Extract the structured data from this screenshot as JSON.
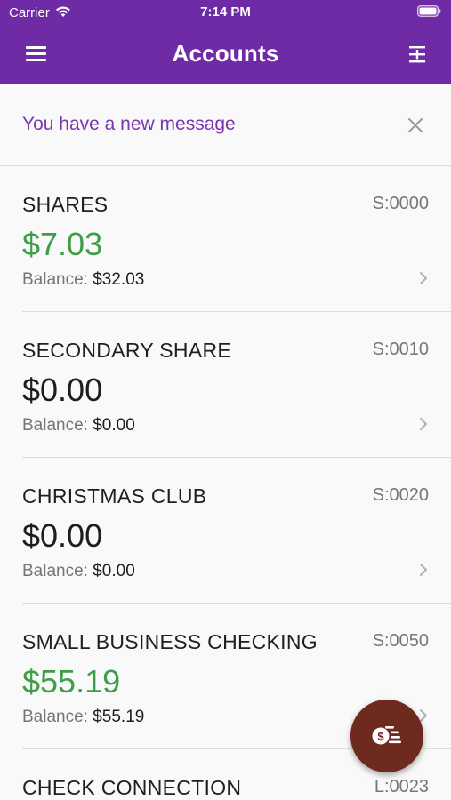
{
  "status_bar": {
    "carrier": "Carrier",
    "time": "7:14 PM"
  },
  "nav": {
    "title": "Accounts"
  },
  "message": {
    "text": "You have a new message"
  },
  "accounts": [
    {
      "name": "SHARES",
      "id": "S:0000",
      "available": "$7.03",
      "balance_label": "Balance:",
      "balance": "$32.03"
    },
    {
      "name": "SECONDARY SHARE",
      "id": "S:0010",
      "available": "$0.00",
      "balance_label": "Balance:",
      "balance": "$0.00"
    },
    {
      "name": "CHRISTMAS CLUB",
      "id": "S:0020",
      "available": "$0.00",
      "balance_label": "Balance:",
      "balance": "$0.00"
    },
    {
      "name": "SMALL BUSINESS CHECKING",
      "id": "S:0050",
      "available": "$55.19",
      "balance_label": "Balance:",
      "balance": "$55.19"
    },
    {
      "name": "CHECK CONNECTION",
      "id": "L:0023"
    }
  ],
  "icons": {
    "wifi": "wifi-icon",
    "battery": "battery-icon",
    "menu": "hamburger-menu-icon",
    "expand": "expand-collapse-icon",
    "close": "close-icon",
    "chevron": "chevron-right-icon",
    "fab": "money-transfer-icon"
  },
  "colors": {
    "header": "#6f2aa6",
    "message_text": "#7a35b0",
    "positive_amount": "#3e9e47",
    "fab": "#6e2a1f"
  }
}
